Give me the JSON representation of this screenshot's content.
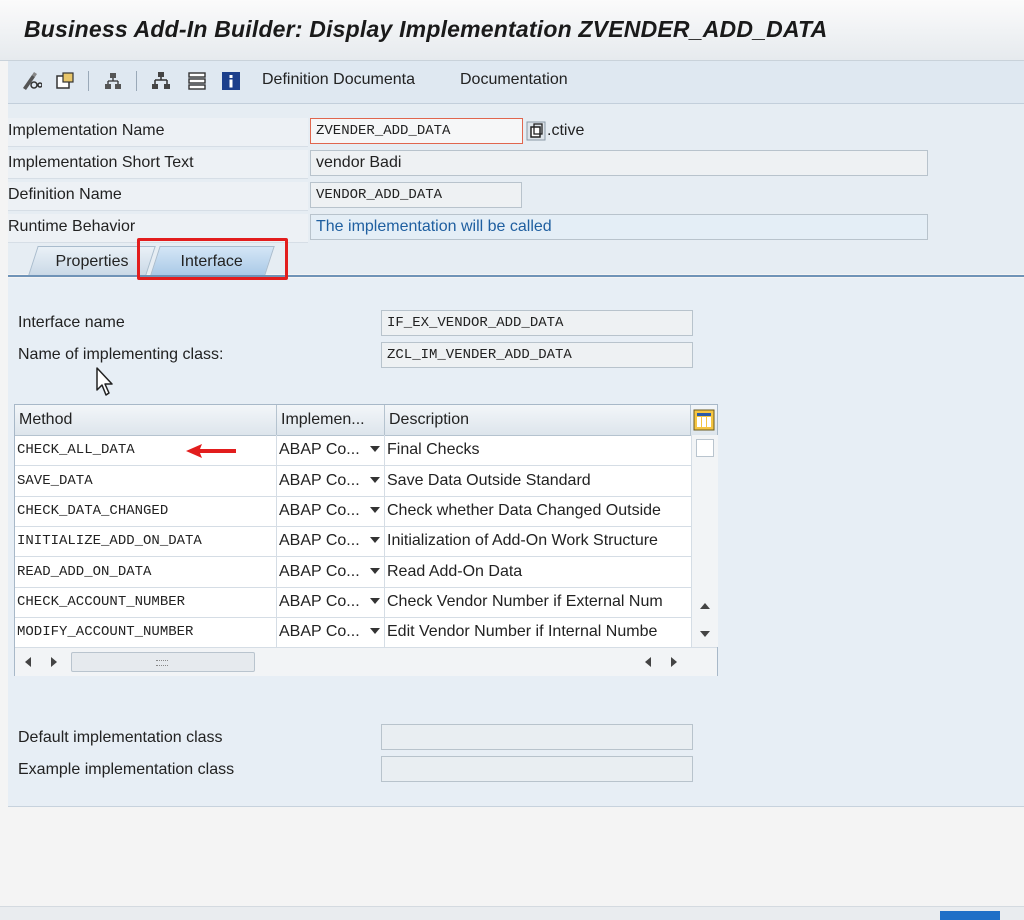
{
  "window": {
    "title": "Business Add-In Builder: Display Implementation ZVENDER_ADD_DATA"
  },
  "toolbar": {
    "icons": [
      "pencil-glasses-icon",
      "other-object-icon",
      "hierarchy-icon",
      "tree-icon",
      "stack-icon",
      "info-icon"
    ],
    "definition_doc_label": "Definition Documenta",
    "documentation_label": "Documentation"
  },
  "header": {
    "impl_name_label": "Implementation Name",
    "impl_name_value": "ZVENDER_ADD_DATA",
    "active_status": ".ctive",
    "short_text_label": "Implementation Short Text",
    "short_text_value": "vendor Badi",
    "def_name_label": "Definition Name",
    "def_name_value": "VENDOR_ADD_DATA",
    "runtime_label": "Runtime Behavior",
    "runtime_value": "The implementation will be called"
  },
  "tabs": [
    {
      "label": "Properties",
      "active": false
    },
    {
      "label": "Interface",
      "active": true
    }
  ],
  "interface": {
    "iface_name_label": "Interface name",
    "iface_name_value": "IF_EX_VENDOR_ADD_DATA",
    "impl_class_label": "Name of implementing class:",
    "impl_class_value": "ZCL_IM_VENDER_ADD_DATA"
  },
  "methods_table": {
    "columns": [
      "Method",
      "Implemen...",
      "Description"
    ],
    "rows": [
      {
        "method": "CHECK_ALL_DATA",
        "impl": "ABAP Co...",
        "description": "Final Checks"
      },
      {
        "method": "SAVE_DATA",
        "impl": "ABAP Co...",
        "description": "Save Data Outside Standard"
      },
      {
        "method": "CHECK_DATA_CHANGED",
        "impl": "ABAP Co...",
        "description": "Check whether Data Changed Outside"
      },
      {
        "method": "INITIALIZE_ADD_ON_DATA",
        "impl": "ABAP Co...",
        "description": "Initialization of Add-On Work Structure"
      },
      {
        "method": "READ_ADD_ON_DATA",
        "impl": "ABAP Co...",
        "description": "Read Add-On Data"
      },
      {
        "method": "CHECK_ACCOUNT_NUMBER",
        "impl": "ABAP Co...",
        "description": "Check Vendor Number if External Num"
      },
      {
        "method": "MODIFY_ACCOUNT_NUMBER",
        "impl": "ABAP Co...",
        "description": "Edit Vendor Number if Internal Numbe"
      }
    ]
  },
  "bottom": {
    "default_impl_label": "Default implementation class",
    "default_impl_value": "",
    "example_impl_label": "Example implementation class",
    "example_impl_value": ""
  },
  "colors": {
    "highlight": "#e21d1d",
    "accent_blue": "#1f5fa0"
  }
}
